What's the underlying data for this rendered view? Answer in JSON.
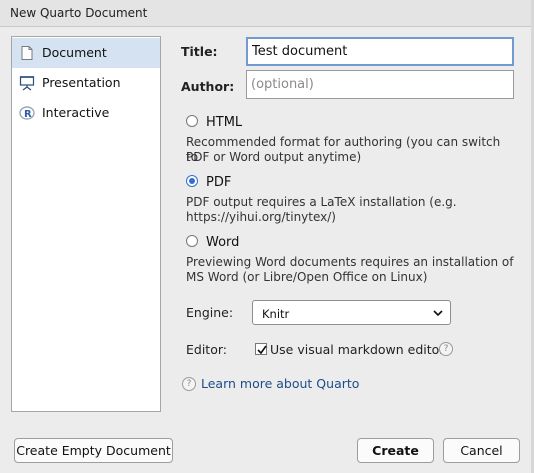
{
  "window": {
    "title": "New Quarto Document"
  },
  "sidebar": {
    "items": [
      {
        "label": "Document",
        "icon": "document-icon",
        "selected": true
      },
      {
        "label": "Presentation",
        "icon": "presentation-icon",
        "selected": false
      },
      {
        "label": "Interactive",
        "icon": "r-logo-icon",
        "selected": false
      }
    ]
  },
  "form": {
    "title_label": "Title:",
    "title_value": "Test document",
    "author_label": "Author:",
    "author_placeholder": "(optional)",
    "formats": [
      {
        "name": "HTML",
        "checked": false,
        "desc_lines": [
          "Recommended format for authoring (you can switch to",
          "PDF or Word output anytime)"
        ]
      },
      {
        "name": "PDF",
        "checked": true,
        "desc_lines": [
          "PDF output requires a LaTeX installation (e.g.",
          "https://yihui.org/tinytex/)"
        ]
      },
      {
        "name": "Word",
        "checked": false,
        "desc_lines": [
          "Previewing Word documents requires an installation of",
          "MS Word (or Libre/Open Office on Linux)"
        ]
      }
    ],
    "engine_label": "Engine:",
    "engine_value": "Knitr",
    "editor_label": "Editor:",
    "visual_editor_label": "Use visual markdown editor",
    "visual_editor_checked": true,
    "help_glyph": "?",
    "learn_more": "Learn more about Quarto"
  },
  "buttons": {
    "create_empty": "Create Empty Document",
    "create": "Create",
    "cancel": "Cancel"
  },
  "colors": {
    "accent": "#2f6fcf",
    "selection": "#d4e2f1",
    "link": "#1e4d8a"
  }
}
